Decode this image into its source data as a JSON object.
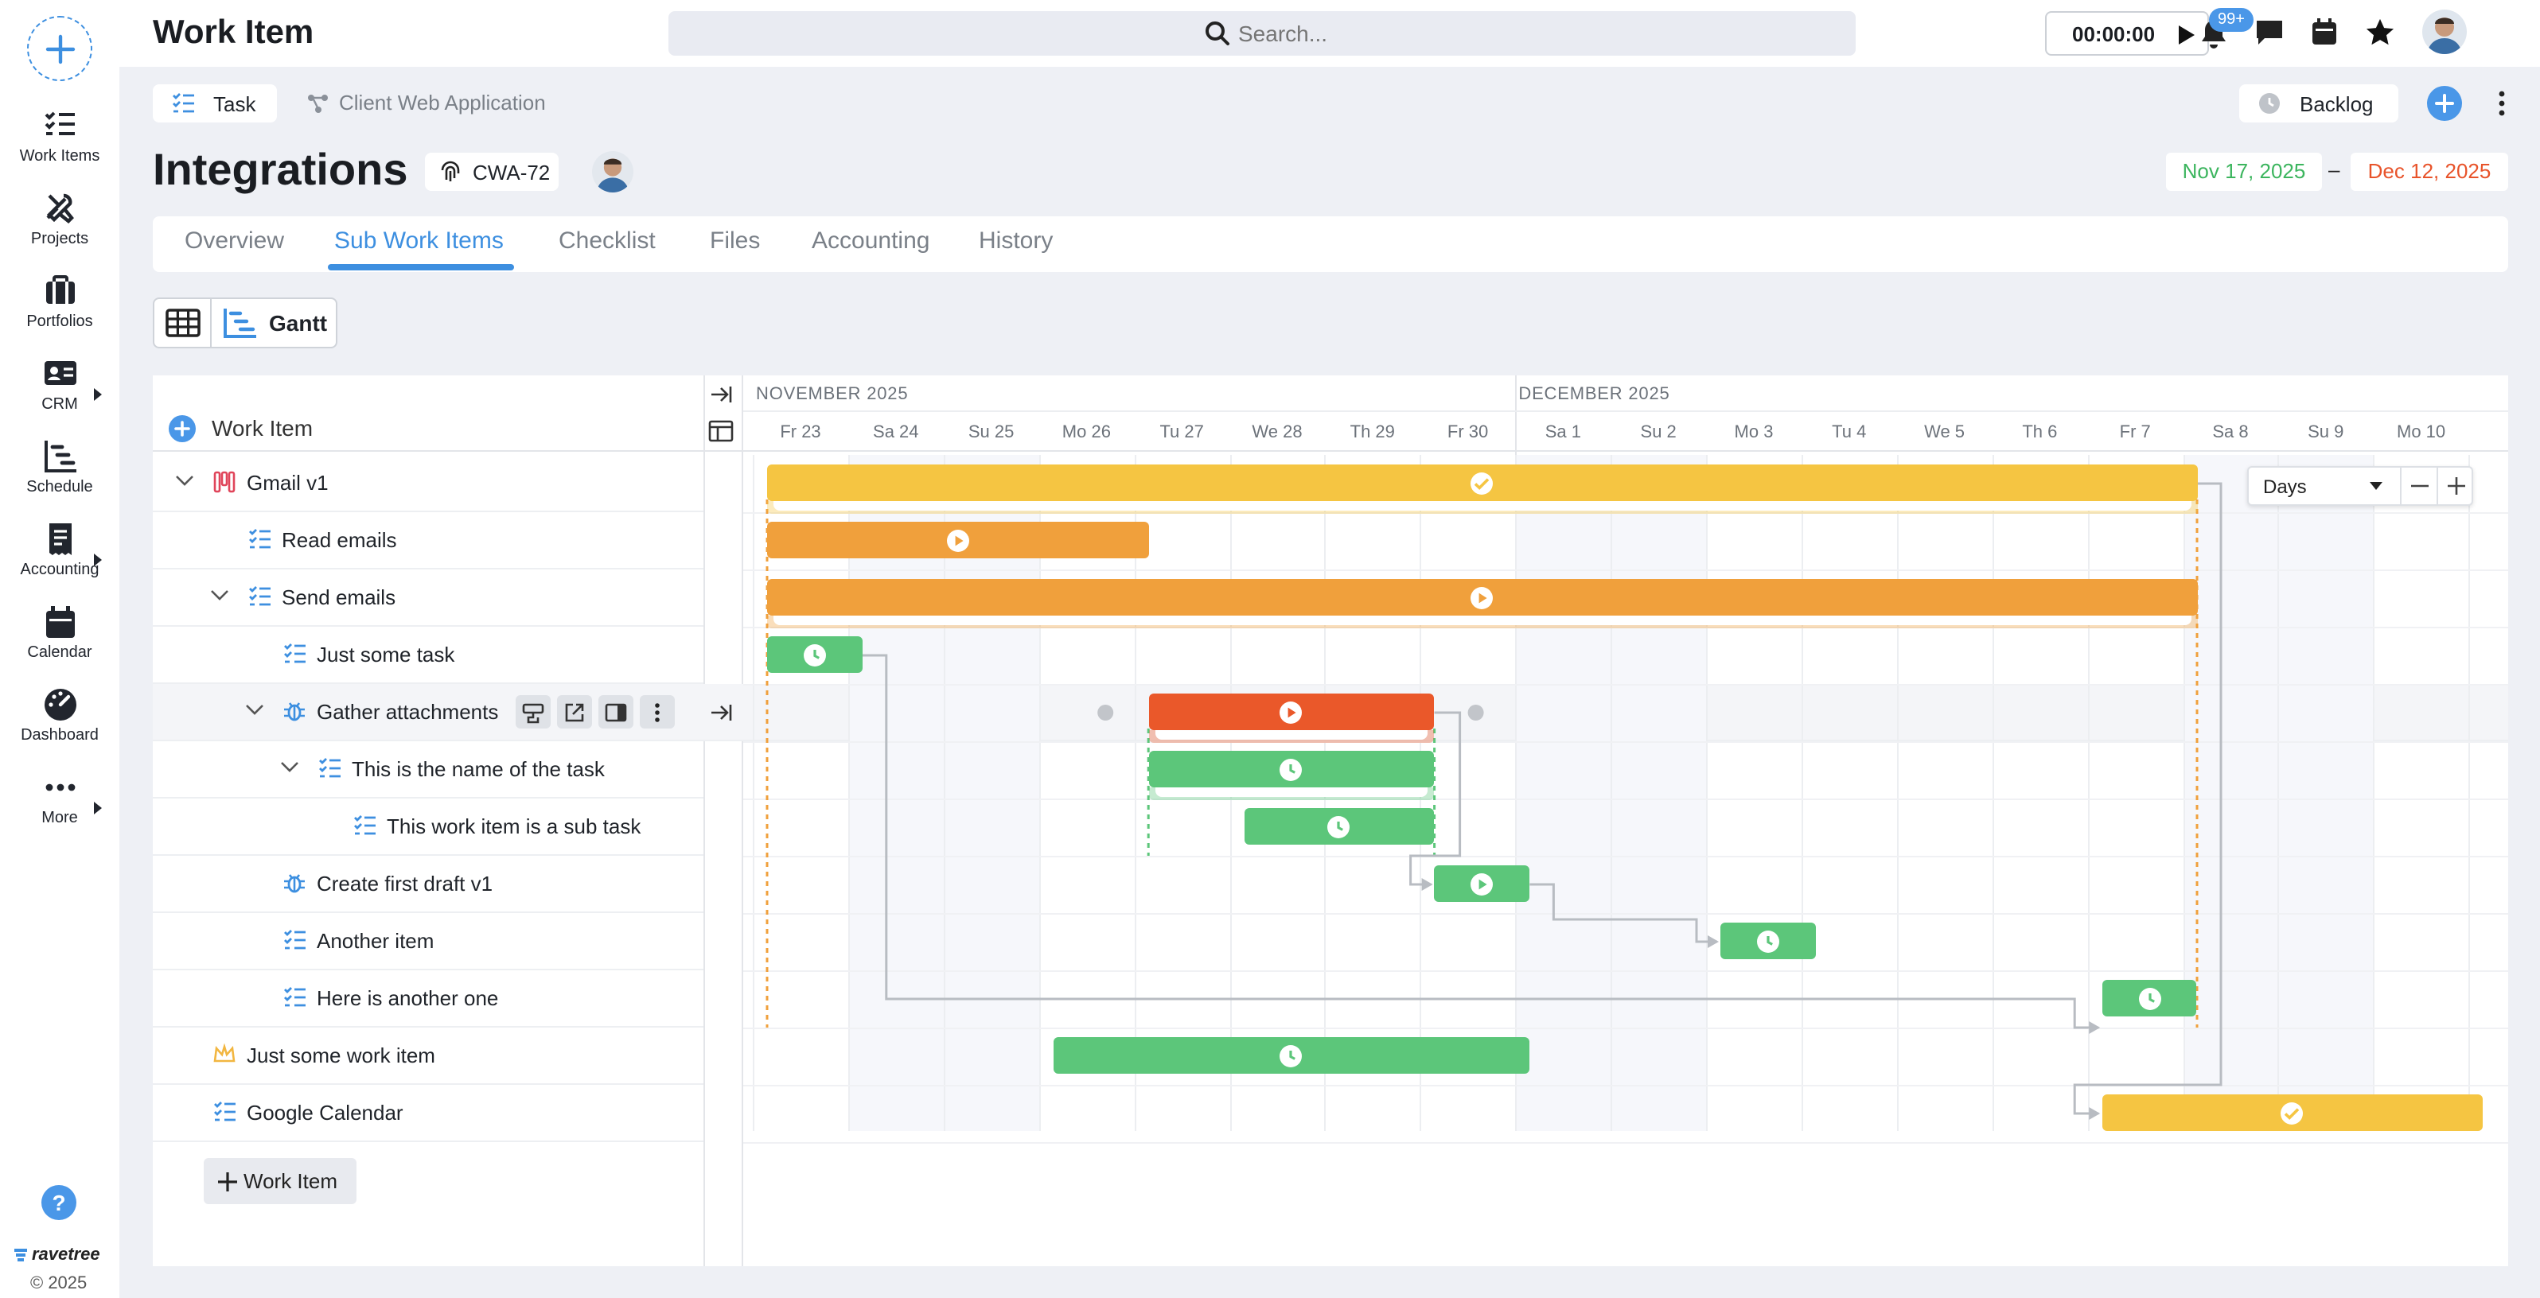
{
  "app": {
    "title": "Work Item",
    "brand": "ravetree",
    "copyright": "© 2025"
  },
  "sidebar": {
    "items": [
      {
        "label": "Work Items",
        "icon": "work-items-icon"
      },
      {
        "label": "Projects",
        "icon": "tools-icon"
      },
      {
        "label": "Portfolios",
        "icon": "briefcase-icon"
      },
      {
        "label": "CRM",
        "icon": "contact-card-icon",
        "submenu": true
      },
      {
        "label": "Schedule",
        "icon": "schedule-icon"
      },
      {
        "label": "Accounting",
        "icon": "receipt-icon",
        "submenu": true
      },
      {
        "label": "Calendar",
        "icon": "calendar-icon"
      },
      {
        "label": "Dashboard",
        "icon": "gauge-icon"
      },
      {
        "label": "More",
        "icon": "ellipsis-icon",
        "submenu": true
      }
    ]
  },
  "search": {
    "placeholder": "Search..."
  },
  "timer": {
    "value": "00:00:00"
  },
  "notifications": {
    "badge": "99+"
  },
  "breadcrumb": {
    "type_label": "Task",
    "project": "Client Web Application"
  },
  "status": {
    "label": "Backlog"
  },
  "work_item": {
    "title": "Integrations",
    "id": "CWA-72",
    "start_date": "Nov 17, 2025",
    "date_sep": "–",
    "end_date": "Dec 12, 2025"
  },
  "tabs": [
    "Overview",
    "Sub Work Items",
    "Checklist",
    "Files",
    "Accounting",
    "History"
  ],
  "active_tab": "Sub Work Items",
  "view_toggle": {
    "gantt_label": "Gantt"
  },
  "gantt": {
    "column_header": "Work Item",
    "months": [
      "NOVEMBER 2025",
      "DECEMBER 2025"
    ],
    "days": [
      "Fr 23",
      "Sa 24",
      "Su 25",
      "Mo 26",
      "Tu 27",
      "We 28",
      "Th 29",
      "Fr 30",
      "Sa 1",
      "Su 2",
      "Mo 3",
      "Tu 4",
      "We 5",
      "Th 6",
      "Fr 7",
      "Sa 8",
      "Su 9",
      "Mo 10"
    ],
    "zoom": {
      "unit": "Days"
    },
    "add_label": "Work Item",
    "rows": [
      {
        "label": "Gmail v1",
        "icon": "epic-icon",
        "level": 0,
        "expanded": true,
        "bar": {
          "start": 0,
          "end": 15,
          "color": "#f5c542",
          "status": "check"
        }
      },
      {
        "label": "Read emails",
        "icon": "task-icon",
        "level": 1,
        "bar": {
          "start": 0,
          "end": 4,
          "color": "#f0a03c",
          "status": "play"
        }
      },
      {
        "label": "Send emails",
        "icon": "task-icon",
        "level": 1,
        "expanded": true,
        "bar": {
          "start": 0,
          "end": 15,
          "color": "#f0a03c",
          "status": "play"
        }
      },
      {
        "label": "Just some task",
        "icon": "task-icon",
        "level": 2,
        "bar": {
          "start": 0,
          "end": 1,
          "color": "#5cc67a",
          "status": "clock"
        }
      },
      {
        "label": "Gather attachments",
        "icon": "bug-icon",
        "level": 2,
        "expanded": true,
        "hovered": true,
        "bar": {
          "start": 4,
          "end": 7,
          "color": "#ea582a",
          "status": "play"
        }
      },
      {
        "label": "This is the name of the task",
        "icon": "task-icon",
        "level": 3,
        "expanded": true,
        "bar": {
          "start": 4,
          "end": 7,
          "color": "#5cc67a",
          "status": "clock"
        }
      },
      {
        "label": "This work item is a sub task",
        "icon": "task-icon",
        "level": 4,
        "bar": {
          "start": 5,
          "end": 7,
          "color": "#5cc67a",
          "status": "clock"
        }
      },
      {
        "label": "Create first draft v1",
        "icon": "bug-icon",
        "level": 2,
        "bar": {
          "start": 7,
          "end": 8,
          "color": "#5cc67a",
          "status": "play"
        }
      },
      {
        "label": "Another item",
        "icon": "task-icon",
        "level": 2,
        "bar": {
          "start": 10,
          "end": 11,
          "color": "#5cc67a",
          "status": "clock"
        }
      },
      {
        "label": "Here is another one",
        "icon": "task-icon",
        "level": 2,
        "bar": {
          "start": 14,
          "end": 15,
          "color": "#5cc67a",
          "status": "clock"
        }
      },
      {
        "label": "Just some work item",
        "icon": "crown-icon",
        "level": 0,
        "bar": {
          "start": 3,
          "end": 8,
          "color": "#5cc67a",
          "status": "clock"
        }
      },
      {
        "label": "Google Calendar",
        "icon": "task-icon",
        "level": 0,
        "bar": {
          "start": 14,
          "end": 18,
          "color": "#f5c542",
          "status": "check"
        }
      }
    ]
  }
}
